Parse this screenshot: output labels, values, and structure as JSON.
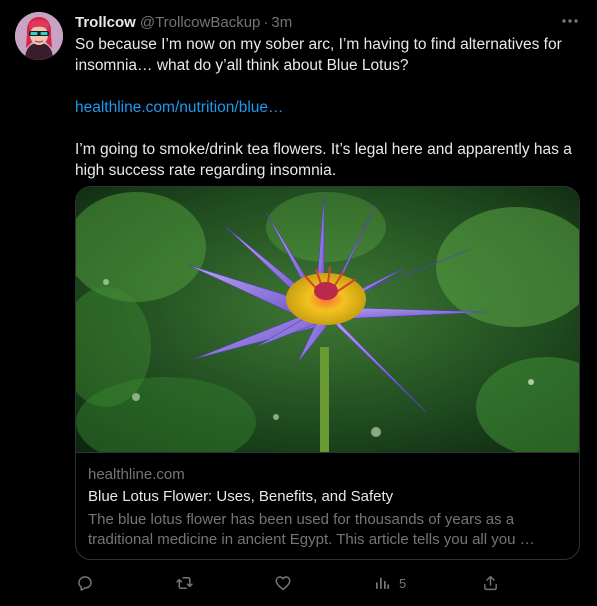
{
  "tweet": {
    "display_name": "Trollcow",
    "handle": "@TrollcowBackup",
    "separator": "·",
    "time": "3m",
    "text_line1": "So because I’m now on my sober arc, I’m having to find alternatives for insomnia… what do y’all think about Blue Lotus?",
    "link_text": "healthline.com/nutrition/blue…",
    "text_line2": "I’m going to smoke/drink tea flowers. It’s legal here and apparently has a high success rate regarding insomnia."
  },
  "card": {
    "domain": "healthline.com",
    "title": "Blue Lotus Flower: Uses, Benefits, and Safety",
    "description": "The blue lotus flower has been used for thousands of years as a traditional medicine in ancient Egypt. This article tells you all you …"
  },
  "actions": {
    "reply_icon": "reply-icon",
    "retweet_icon": "retweet-icon",
    "like_icon": "like-icon",
    "views_icon": "views-icon",
    "views_count": "5",
    "share_icon": "share-icon"
  },
  "colors": {
    "background": "#000000",
    "text": "#e7e9ea",
    "muted": "#71767b",
    "link": "#1d9bf0",
    "border": "#2f3336"
  }
}
